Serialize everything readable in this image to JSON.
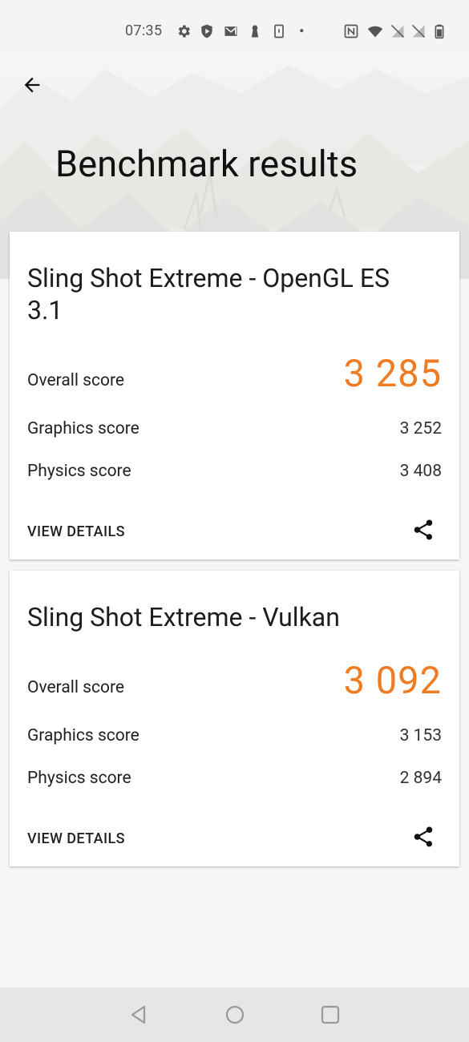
{
  "status_bar": {
    "time": "07:35",
    "left_icons": [
      "settings-icon",
      "shield-play-icon",
      "gmail-icon",
      "keyhole-icon",
      "phone-notification-icon",
      "dot-icon"
    ],
    "right_icons": [
      "nfc-icon",
      "wifi-icon",
      "no-signal-icon",
      "no-signal-icon",
      "battery-icon"
    ]
  },
  "header": {
    "title": "Benchmark results",
    "back_icon": "arrow-back-icon"
  },
  "results": [
    {
      "title": "Sling Shot Extreme - OpenGL ES 3.1",
      "overall_label": "Overall score",
      "overall_value": "3 285",
      "graphics_label": "Graphics score",
      "graphics_value": "3 252",
      "physics_label": "Physics score",
      "physics_value": "3 408",
      "details_label": "VIEW DETAILS",
      "share_icon": "share-icon"
    },
    {
      "title": "Sling Shot Extreme - Vulkan",
      "overall_label": "Overall score",
      "overall_value": "3 092",
      "graphics_label": "Graphics score",
      "graphics_value": "3 153",
      "physics_label": "Physics score",
      "physics_value": "2 894",
      "details_label": "VIEW DETAILS",
      "share_icon": "share-icon"
    }
  ],
  "nav_bar": {
    "buttons": [
      "back-triangle-icon",
      "home-circle-icon",
      "recents-square-icon"
    ]
  },
  "colors": {
    "accent_score": "#ef7c22",
    "background": "#f6f6f6",
    "card": "#ffffff",
    "navbar": "#e6e6e6"
  }
}
